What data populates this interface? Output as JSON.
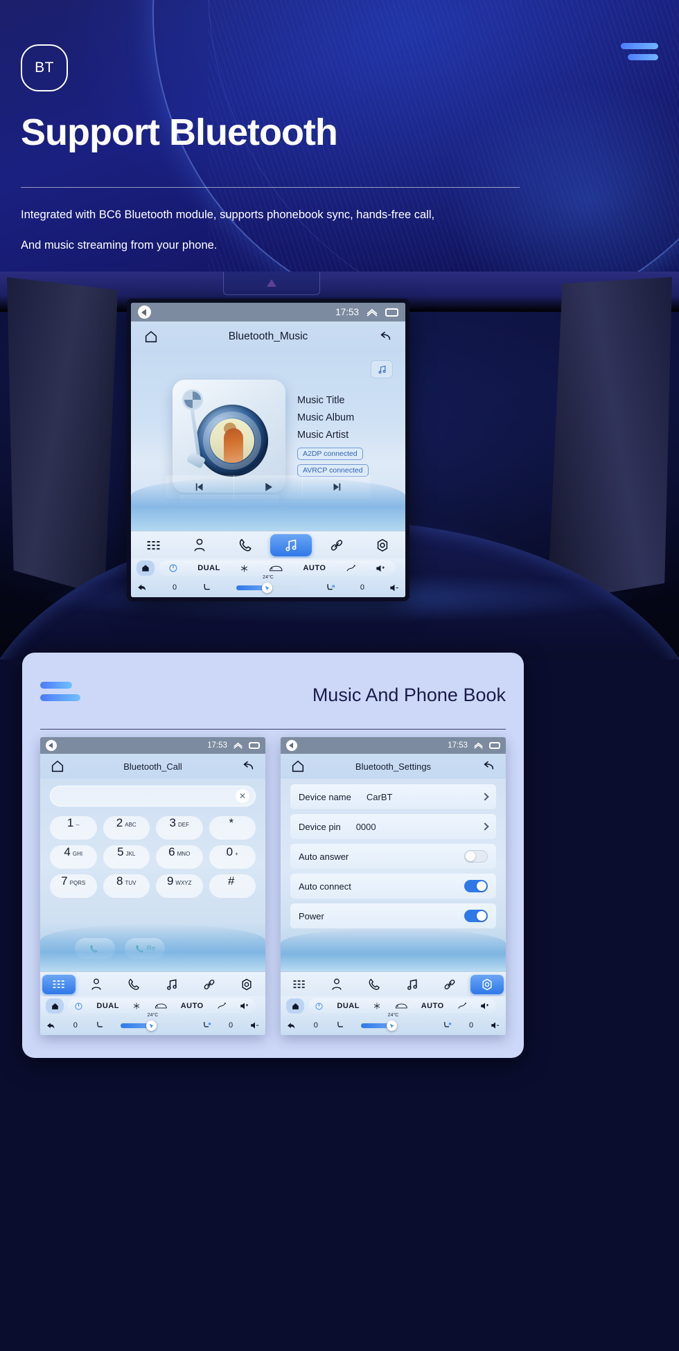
{
  "hero": {
    "badge_text": "BT",
    "title": "Support Bluetooth",
    "subtitle_line1": "Integrated with BC6 Bluetooth module, supports phonebook sync, hands-free call,",
    "subtitle_line2": "And music streaming from your phone.",
    "accent_color": "#4e7dfb"
  },
  "main_screen": {
    "status_bar": {
      "time": "17:53",
      "back_icon": "back-icon",
      "chevron_icon": "chevron-up-icon",
      "window_icon": "window-icon"
    },
    "title_bar": {
      "home_icon": "home-icon",
      "title": "Bluetooth_Music",
      "back_icon": "undo-icon"
    },
    "music": {
      "chip_icon": "music-note-icon",
      "title": "Music Title",
      "album": "Music Album",
      "artist": "Music Artist",
      "badge_a2dp": "A2DP  connected",
      "badge_avrcp": "AVRCP connected"
    },
    "transport": {
      "prev": "previous-icon",
      "play": "play-icon",
      "next": "next-icon"
    },
    "nav_items": [
      {
        "name": "apps",
        "icon": "grid-icon",
        "active": false
      },
      {
        "name": "contacts",
        "icon": "person-icon",
        "active": false
      },
      {
        "name": "phone",
        "icon": "phone-icon",
        "active": false
      },
      {
        "name": "music",
        "icon": "music-note-icon",
        "active": true
      },
      {
        "name": "link",
        "icon": "link-icon",
        "active": false
      },
      {
        "name": "settings",
        "icon": "gear-icon",
        "active": false
      }
    ],
    "climate": {
      "power": "power-icon",
      "dual": "DUAL",
      "snowflake": "snowflake-icon",
      "defrost": "defrost-icon",
      "auto": "AUTO",
      "seat_air": "air-flow-icon",
      "vol_up": "volume-up-icon",
      "vol_down": "volume-down-icon",
      "temp": "24°C",
      "left_value": "0",
      "right_value": "0",
      "seat_icon": "seat-icon",
      "seat_heat_icon": "seat-heat-icon",
      "home_icon": "home-icon",
      "back_icon": "back-arrow-icon",
      "fan_icon": "fan-icon"
    }
  },
  "card": {
    "title": "Music And Phone Book",
    "call_screen": {
      "status_bar": {
        "time": "17:53"
      },
      "title_bar": {
        "home_icon": "home-icon",
        "title": "Bluetooth_Call",
        "back_icon": "undo-icon"
      },
      "dial_value": "",
      "clear_icon": "close-icon",
      "keys": [
        {
          "digit": "1",
          "letters": "--"
        },
        {
          "digit": "2",
          "letters": "ABC"
        },
        {
          "digit": "3",
          "letters": "DEF"
        },
        {
          "digit": "*",
          "letters": ""
        },
        {
          "digit": "4",
          "letters": "GHI"
        },
        {
          "digit": "5",
          "letters": "JKL"
        },
        {
          "digit": "6",
          "letters": "MNO"
        },
        {
          "digit": "0",
          "letters": "+"
        },
        {
          "digit": "7",
          "letters": "PQRS"
        },
        {
          "digit": "8",
          "letters": "TUV"
        },
        {
          "digit": "9",
          "letters": "WXYZ"
        },
        {
          "digit": "#",
          "letters": ""
        }
      ],
      "call_button_label": "",
      "redial_button_label": "Re",
      "active_nav": "apps"
    },
    "settings_screen": {
      "status_bar": {
        "time": "17:53"
      },
      "title_bar": {
        "home_icon": "home-icon",
        "title": "Bluetooth_Settings",
        "back_icon": "undo-icon"
      },
      "rows": [
        {
          "label": "Device name",
          "value": "CarBT",
          "control": "chevron"
        },
        {
          "label": "Device pin",
          "value": "0000",
          "control": "chevron"
        },
        {
          "label": "Auto answer",
          "value": "",
          "control": "toggle-off"
        },
        {
          "label": "Auto connect",
          "value": "",
          "control": "toggle-on"
        },
        {
          "label": "Power",
          "value": "",
          "control": "toggle-on"
        }
      ],
      "active_nav": "settings"
    },
    "nav_items": [
      {
        "name": "apps",
        "icon": "grid-icon"
      },
      {
        "name": "contacts",
        "icon": "person-icon"
      },
      {
        "name": "phone",
        "icon": "phone-icon"
      },
      {
        "name": "music",
        "icon": "music-note-icon"
      },
      {
        "name": "link",
        "icon": "link-icon"
      },
      {
        "name": "settings",
        "icon": "gear-icon"
      }
    ],
    "climate": {
      "dual": "DUAL",
      "auto": "AUTO",
      "temp": "24°C",
      "left_value": "0",
      "right_value": "0"
    }
  }
}
